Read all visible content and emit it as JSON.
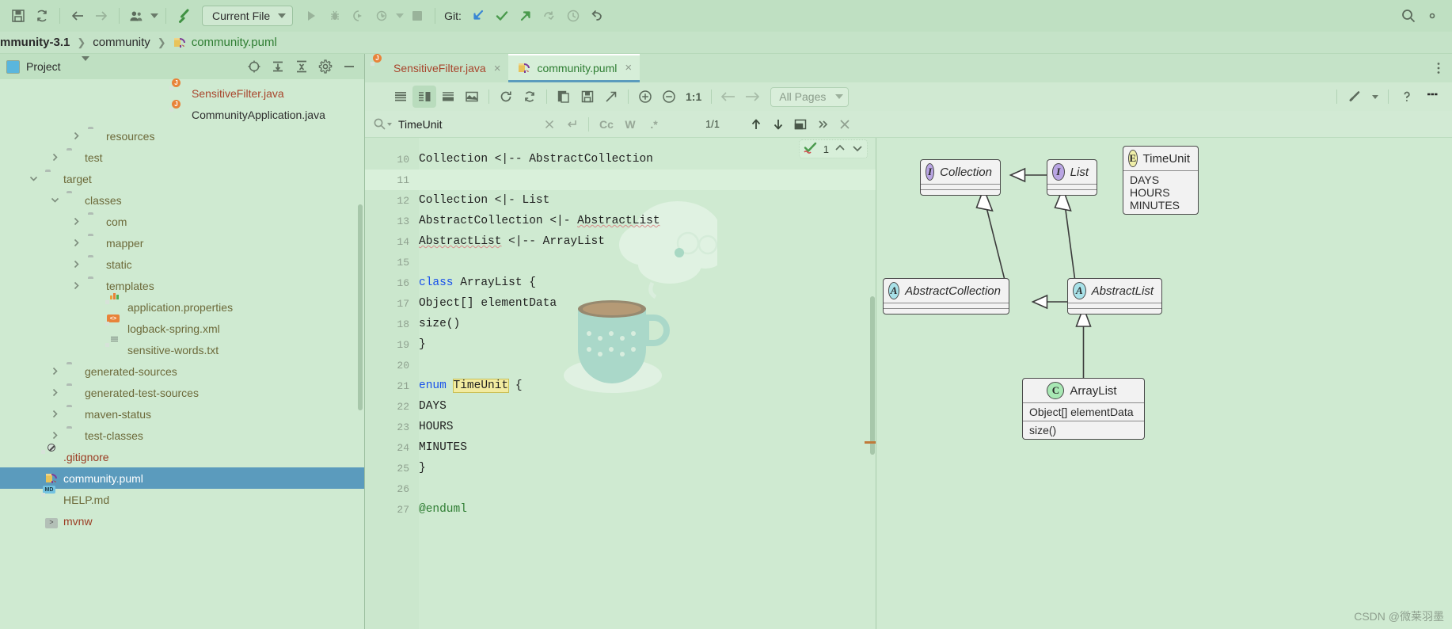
{
  "toolbar": {
    "icons": [
      "save-icon",
      "sync-icon",
      "back-arrow-icon",
      "forward-arrow-icon",
      "user-group-icon",
      "build-hammer-icon"
    ],
    "current_file_label": "Current File",
    "run_icons": [
      "run-icon",
      "debug-icon",
      "run-with-coverage-icon",
      "profiler-icon",
      "stop-icon"
    ],
    "git_label": "Git:",
    "git_icons": [
      "update-project-icon",
      "commit-checkmark-icon",
      "push-arrow-icon",
      "fetch-icon",
      "history-clock-icon",
      "rollback-icon"
    ],
    "right_icons": [
      "search-everywhere-icon",
      "settings-gear-icon"
    ]
  },
  "breadcrumb": {
    "items": [
      {
        "label": "mmunity-3.1",
        "icon": "none",
        "bold": true
      },
      {
        "label": "community",
        "icon": "none",
        "bold": false
      },
      {
        "label": "community.puml",
        "icon": "puml-file-icon",
        "bold": false
      }
    ],
    "separator": "❯"
  },
  "project_panel": {
    "title": "Project",
    "header_icons": [
      "locate-target-icon",
      "expand-all-icon",
      "collapse-all-icon",
      "settings-gear-icon",
      "hide-minimize-icon"
    ],
    "tree": [
      {
        "label": "SensitiveFilter.java",
        "indent": 7,
        "arrow": "none",
        "icon": "java-file-icon",
        "color": "java"
      },
      {
        "label": "CommunityApplication.java",
        "indent": 7,
        "arrow": "none",
        "icon": "java-file-icon",
        "color": "plain"
      },
      {
        "label": "resources",
        "indent": 3,
        "arrow": "collapsed",
        "icon": "folder-icon",
        "color": "lbl"
      },
      {
        "label": "test",
        "indent": 2,
        "arrow": "collapsed",
        "icon": "folder-icon",
        "color": "lbl"
      },
      {
        "label": "target",
        "indent": 1,
        "arrow": "expanded",
        "icon": "folder-icon",
        "color": "lbl"
      },
      {
        "label": "classes",
        "indent": 2,
        "arrow": "expanded",
        "icon": "folder-icon",
        "color": "lbl"
      },
      {
        "label": "com",
        "indent": 3,
        "arrow": "collapsed",
        "icon": "folder-icon",
        "color": "lbl"
      },
      {
        "label": "mapper",
        "indent": 3,
        "arrow": "collapsed",
        "icon": "folder-icon",
        "color": "lbl"
      },
      {
        "label": "static",
        "indent": 3,
        "arrow": "collapsed",
        "icon": "folder-icon",
        "color": "lbl"
      },
      {
        "label": "templates",
        "indent": 3,
        "arrow": "collapsed",
        "icon": "folder-icon",
        "color": "lbl"
      },
      {
        "label": "application.properties",
        "indent": 4,
        "arrow": "none",
        "icon": "properties-file-icon",
        "color": "lbl"
      },
      {
        "label": "logback-spring.xml",
        "indent": 4,
        "arrow": "none",
        "icon": "xml-file-icon",
        "color": "lbl"
      },
      {
        "label": "sensitive-words.txt",
        "indent": 4,
        "arrow": "none",
        "icon": "text-file-icon",
        "color": "lbl"
      },
      {
        "label": "generated-sources",
        "indent": 2,
        "arrow": "collapsed",
        "icon": "folder-icon",
        "color": "lbl"
      },
      {
        "label": "generated-test-sources",
        "indent": 2,
        "arrow": "collapsed",
        "icon": "folder-icon",
        "color": "lbl"
      },
      {
        "label": "maven-status",
        "indent": 2,
        "arrow": "collapsed",
        "icon": "folder-icon",
        "color": "lbl"
      },
      {
        "label": "test-classes",
        "indent": 2,
        "arrow": "collapsed",
        "icon": "folder-icon",
        "color": "lbl"
      },
      {
        "label": ".gitignore",
        "indent": 1,
        "arrow": "none",
        "icon": "gitignore-file-icon",
        "color": "red"
      },
      {
        "label": "community.puml",
        "indent": 1,
        "arrow": "none",
        "icon": "puml-file-icon",
        "color": "plain",
        "selected": true
      },
      {
        "label": "HELP.md",
        "indent": 1,
        "arrow": "none",
        "icon": "markdown-file-icon",
        "color": "lbl"
      },
      {
        "label": "mvnw",
        "indent": 1,
        "arrow": "none",
        "icon": "script-file-icon",
        "color": "red"
      }
    ]
  },
  "editor": {
    "tabs": [
      {
        "label": "SensitiveFilter.java",
        "icon": "java-file-icon",
        "kind": "java",
        "active": false,
        "close": "×"
      },
      {
        "label": "community.puml",
        "icon": "puml-file-icon",
        "kind": "puml",
        "active": true,
        "close": "×"
      }
    ],
    "tabs_right_icon": "more-vertical-icon"
  },
  "preview_toolbar": {
    "layout_icons": [
      "editor-only-icon",
      "editor-and-preview-icon",
      "preview-horizontal-icon",
      "preview-only-icon"
    ],
    "action_icons": [
      "refresh-icon",
      "reload-diagram-icon",
      "copy-icon",
      "save-diagram-icon",
      "open-external-icon"
    ],
    "zoom_in_icon": "zoom-in-icon",
    "zoom_out_icon": "zoom-out-icon",
    "zoom_reset_label": "1:1",
    "nav_prev_icon": "arrow-left-icon",
    "nav_next_icon": "arrow-right-icon",
    "pages_select": "All Pages",
    "right_icons": [
      "wrench-settings-icon",
      "help-question-icon",
      "more-dashes-icon"
    ]
  },
  "find_bar": {
    "search_icon": "magnifier-dropdown-icon",
    "query": "TimeUnit",
    "clear_icon": "close-icon",
    "regex_newline_icon": "new-line-icon",
    "match_case_label": "Cc",
    "words_label": "W",
    "regex_label": ".*",
    "count": "1/1",
    "prev_icon": "arrow-up-icon",
    "next_icon": "arrow-down-icon",
    "select_all_icon": "open-in-panel-icon",
    "more_icon": "chevron-double-right-icon",
    "close_icon": "close-icon"
  },
  "inspection_widget": {
    "status_icon": "inspection-ok-icon",
    "count": "1",
    "up_icon": "chevron-up-icon",
    "down_icon": "chevron-down-icon"
  },
  "code": {
    "lines": [
      {
        "num": "10",
        "text": "Collection <|-- AbstractCollection",
        "style": "plain"
      },
      {
        "num": "11",
        "text": "",
        "style": "highlight"
      },
      {
        "num": "12",
        "text": "Collection <|- List",
        "style": "plain"
      },
      {
        "num": "13",
        "text": "AbstractCollection <|- AbstractList",
        "style": "plain"
      },
      {
        "num": "14",
        "text": "AbstractList <|-- ArrayList",
        "style": "plain"
      },
      {
        "num": "15",
        "text": "",
        "style": "plain"
      },
      {
        "num": "16",
        "text": "class ArrayList {",
        "style": "keyword-class"
      },
      {
        "num": "17",
        "text": "Object[] elementData",
        "style": "plain"
      },
      {
        "num": "18",
        "text": "size()",
        "style": "plain"
      },
      {
        "num": "19",
        "text": "}",
        "style": "plain"
      },
      {
        "num": "20",
        "text": "",
        "style": "plain"
      },
      {
        "num": "21",
        "text": "enum TimeUnit {",
        "style": "keyword-enum-match"
      },
      {
        "num": "22",
        "text": "DAYS",
        "style": "plain"
      },
      {
        "num": "23",
        "text": "HOURS",
        "style": "plain"
      },
      {
        "num": "24",
        "text": "MINUTES",
        "style": "plain"
      },
      {
        "num": "25",
        "text": "}",
        "style": "plain"
      },
      {
        "num": "26",
        "text": "",
        "style": "plain"
      },
      {
        "num": "27",
        "text": "@enduml",
        "style": "tag"
      }
    ],
    "kw_class": "class",
    "kw_enum": "enum",
    "match_token": "TimeUnit",
    "class_rest": " ArrayList {",
    "enum_rest": " {"
  },
  "uml": {
    "nodes": [
      {
        "id": "collection",
        "name": "Collection",
        "stereotype": "I",
        "italic": true,
        "sections": []
      },
      {
        "id": "list",
        "name": "List",
        "stereotype": "I",
        "italic": true,
        "sections": []
      },
      {
        "id": "abstractcollection",
        "name": "AbstractCollection",
        "stereotype": "A",
        "italic": true,
        "sections": []
      },
      {
        "id": "abstractlist",
        "name": "AbstractList",
        "stereotype": "A",
        "italic": true,
        "sections": []
      },
      {
        "id": "arraylist",
        "name": "ArrayList",
        "stereotype": "C",
        "italic": false,
        "sections": [
          "Object[] elementData",
          "size()"
        ]
      },
      {
        "id": "timeunit",
        "name": "TimeUnit",
        "stereotype": "E",
        "italic": false,
        "sections": [
          "DAYS",
          "HOURS",
          "MINUTES"
        ]
      }
    ],
    "edges": [
      {
        "from": "abstractcollection",
        "to": "collection",
        "type": "extends"
      },
      {
        "from": "list",
        "to": "collection",
        "type": "implements"
      },
      {
        "from": "abstractlist",
        "to": "abstractcollection",
        "type": "extends"
      },
      {
        "from": "abstractlist",
        "to": "list",
        "type": "implements"
      },
      {
        "from": "arraylist",
        "to": "abstractlist",
        "type": "extends"
      }
    ],
    "watermark": "CSDN @微莱羽墨"
  },
  "colors": {
    "background": "#c8e6c9",
    "toolbar": "#bfe0c2",
    "selection": "#5b9bbd",
    "java_text": "#a8452c",
    "puml_text": "#2e7d32",
    "keyword": "#1750eb",
    "match_highlight": "#f2eba0",
    "interface_stereotype": "#b9a5e3",
    "abstract_stereotype": "#a8e1e8",
    "enum_stereotype": "#f0efa8",
    "class_stereotype": "#a8e8b4"
  }
}
